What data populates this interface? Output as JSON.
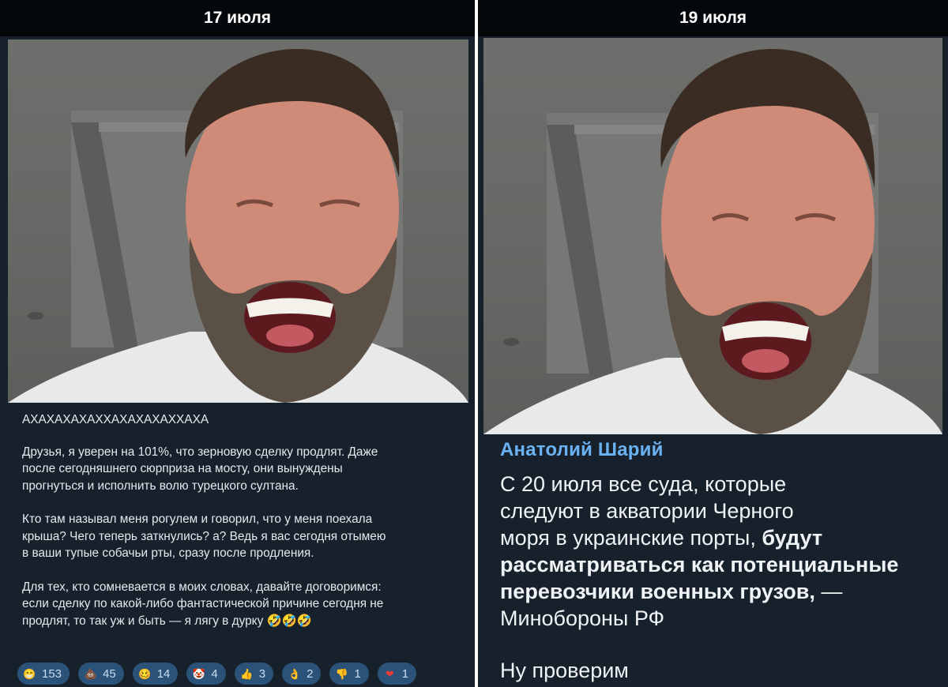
{
  "left_post": {
    "date": "17 июля",
    "paragraphs": [
      "АХАХАХАХАХХАХАХАХАХХАХА",
      "Друзья, я уверен на 101%, что зерновую сделку продлят. Даже\nпосле сегодняшнего сюрприза на мосту, они вынуждены\nпрогнуться и исполнить волю турецкого султана.",
      "Кто там называл меня рогулем и говорил, что у меня поехала\nкрыша? Чего теперь заткнулись? а? Ведь я вас сегодня отымею\nв ваши тупые собачьи рты, сразу после продления.",
      "Для тех, кто сомневается в моих словах, давайте договоримся:\nесли сделку по какой-либо фантастической причине сегодня не\nпродлят, то так уж и быть — я лягу в дурку 🤣🤣🤣"
    ],
    "reactions": [
      {
        "emoji": "😁",
        "icon": "grin-emoji",
        "count": "153"
      },
      {
        "emoji": "💩",
        "icon": "poop-emoji",
        "count": "45"
      },
      {
        "emoji": "🥴",
        "icon": "woozy-face-emoji",
        "count": "14"
      },
      {
        "emoji": "🤡",
        "icon": "clown-emoji",
        "count": "4"
      },
      {
        "emoji": "👍",
        "icon": "thumbs-up-emoji",
        "count": "3"
      },
      {
        "emoji": "👌",
        "icon": "ok-hand-emoji",
        "count": "2"
      },
      {
        "emoji": "👎",
        "icon": "thumbs-down-emoji",
        "count": "1"
      },
      {
        "emoji": "❤",
        "icon": "heart-emoji",
        "count": "1"
      }
    ]
  },
  "right_post": {
    "date": "19 июля",
    "author": "Анатолий Шарий",
    "quote_plain": "С 20 июля все суда, которые\nследуют в акватории Черного\nморя в украинские порты, ",
    "quote_bold": "будут\nрассматриваться как потенциальные\nперевозчики военных грузов,",
    "quote_tail": " —\nМинобороны РФ",
    "footer": "Ну проверим"
  },
  "colors": {
    "panel_bg": "#17212b",
    "header_bg": "#05080b",
    "author_link": "#6ab2f2",
    "reaction_bg": "#2b5278"
  }
}
